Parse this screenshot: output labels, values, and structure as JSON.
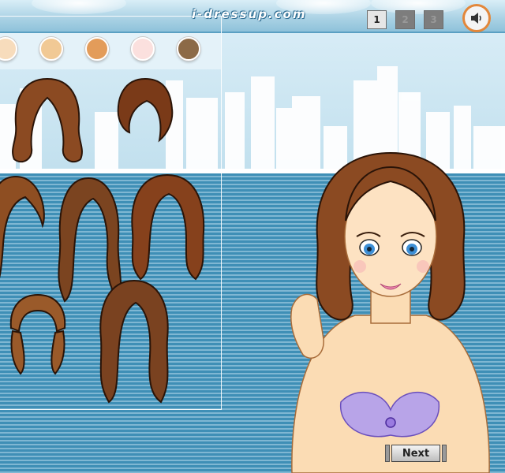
{
  "site_logo": "i-dressup.com",
  "pages": [
    {
      "label": "1",
      "active": true
    },
    {
      "label": "2",
      "active": false
    },
    {
      "label": "3",
      "active": false
    }
  ],
  "sound_icon": "speaker-icon",
  "skin_swatches": [
    "#f7dcbc",
    "#f1c995",
    "#e39c5a",
    "#fbe0de",
    "#8c6a47"
  ],
  "hair_options": [
    {
      "name": "wavy-shoulder",
      "color": "#8b4a22"
    },
    {
      "name": "short-bob-sideswept",
      "color": "#7a3a18"
    },
    {
      "name": "long-side-partial",
      "color": "#8e4e22"
    },
    {
      "name": "long-wavy-loose",
      "color": "#7b4420"
    },
    {
      "name": "long-curly-volume",
      "color": "#86411c"
    },
    {
      "name": "pigtails-bangs",
      "color": "#9a5a2a"
    },
    {
      "name": "long-waves-mid",
      "color": "#7a4220"
    }
  ],
  "next_label": "Next",
  "colors": {
    "accent": "#e3873a",
    "page_active": "#e6e6e6",
    "page_inactive": "#7d7d7d"
  }
}
